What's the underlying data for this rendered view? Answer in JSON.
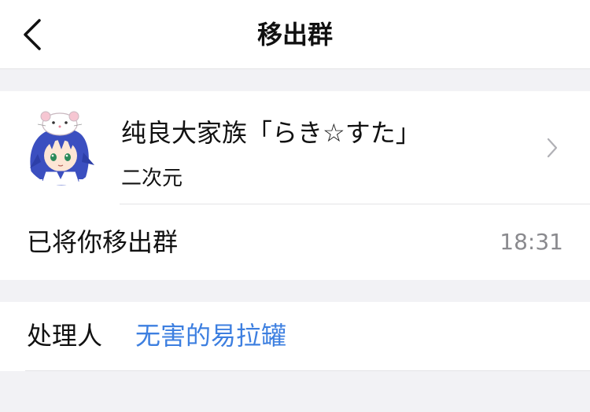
{
  "navbar": {
    "title": "移出群",
    "back_icon": "chevron-left-icon"
  },
  "group": {
    "name": "纯良大家族「らき☆すた」",
    "tag": "二次元",
    "avatar_icon": "anime-girl-avatar",
    "chevron_icon": "chevron-right-icon"
  },
  "notice": {
    "message": "已将你移出群",
    "time": "18:31"
  },
  "handler": {
    "label": "处理人",
    "name": "无害的易拉罐"
  },
  "colors": {
    "background": "#f2f2f5",
    "card": "#ffffff",
    "link": "#3d7fe0",
    "secondary_text": "#8a8a8e"
  }
}
